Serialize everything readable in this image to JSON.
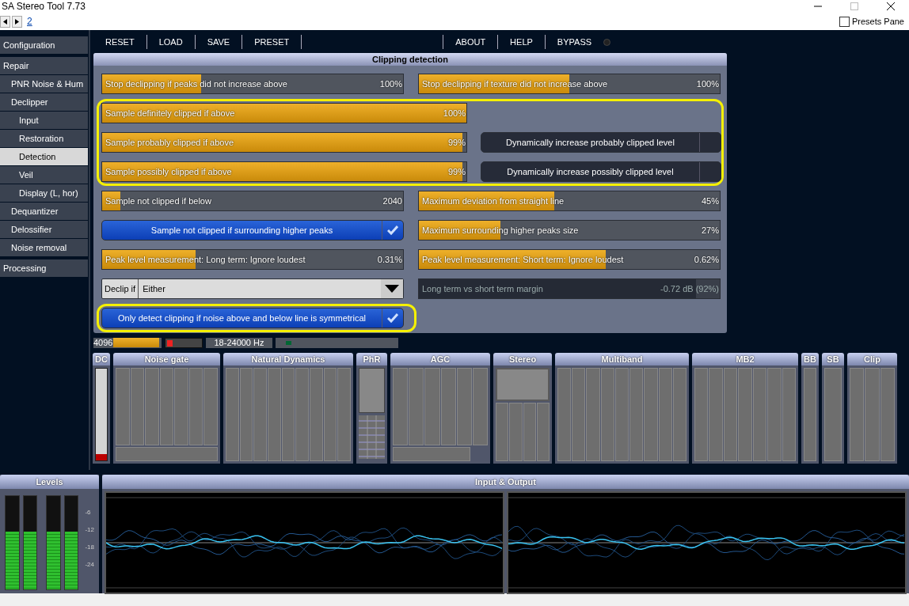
{
  "window": {
    "title": "SA Stereo Tool 7.73"
  },
  "nav": {
    "page": "2"
  },
  "presets_pane": {
    "label": "Presets Pane",
    "checked": false
  },
  "sidebar": {
    "items": [
      {
        "label": "Configuration",
        "selected": false
      },
      {
        "label": "Repair",
        "selected": false,
        "children": [
          {
            "label": "PNR Noise & Hum",
            "selected": false
          },
          {
            "label": "Declipper",
            "selected": false,
            "children": [
              {
                "label": "Input",
                "selected": false
              },
              {
                "label": "Restoration",
                "selected": false
              },
              {
                "label": "Detection",
                "selected": true
              },
              {
                "label": "Veil",
                "selected": false
              },
              {
                "label": "Display (L, hor)",
                "selected": false
              }
            ]
          },
          {
            "label": "Dequantizer",
            "selected": false
          },
          {
            "label": "Delossifier",
            "selected": false
          },
          {
            "label": "Noise removal",
            "selected": false
          }
        ]
      },
      {
        "label": "Processing",
        "selected": false
      }
    ]
  },
  "toolbar": {
    "left": [
      "RESET",
      "LOAD",
      "SAVE",
      "PRESET"
    ],
    "right": [
      "ABOUT",
      "HELP",
      "BYPASS"
    ]
  },
  "panel": {
    "title": "Clipping detection",
    "groups": [
      {
        "highlighted": false,
        "rows": [
          [
            {
              "kind": "slider",
              "label": "Stop declipping if peaks did not increase above",
              "value": "100%",
              "level": 0.33
            },
            {
              "kind": "slider",
              "label": "Stop declipping if texture did not increase above",
              "value": "100%",
              "level": 0.5
            }
          ]
        ]
      },
      {
        "highlighted": true,
        "rows": [
          [
            {
              "kind": "slider",
              "label": "Sample definitely clipped if above",
              "value": "100%",
              "level": 1
            }
          ],
          [
            {
              "kind": "slider",
              "label": "Sample probably clipped if above",
              "value": "99%",
              "level": 0.99
            },
            {
              "kind": "toggle",
              "label": "Dynamically increase probably clipped level",
              "on": false
            }
          ],
          [
            {
              "kind": "slider",
              "label": "Sample possibly clipped if above",
              "value": "99%",
              "level": 0.99
            },
            {
              "kind": "toggle",
              "label": "Dynamically increase possibly clipped level",
              "on": false
            }
          ]
        ]
      },
      {
        "highlighted": false,
        "rows": [
          [
            {
              "kind": "slider",
              "label": "Sample not clipped if below",
              "value": "2040",
              "level": 0.06
            },
            {
              "kind": "slider",
              "label": "Maximum deviation from straight line",
              "value": "45%",
              "level": 0.45
            }
          ],
          [
            {
              "kind": "toggle",
              "label": "Sample not clipped if surrounding higher peaks",
              "on": true
            },
            {
              "kind": "slider",
              "label": "Maximum surrounding higher peaks size",
              "value": "27%",
              "level": 0.27
            }
          ],
          [
            {
              "kind": "slider",
              "label": "Peak level measurement: Long term: Ignore loudest",
              "value": "0.31%",
              "level": 0.31
            },
            {
              "kind": "slider",
              "label": "Peak level measurement: Short term: Ignore loudest",
              "value": "0.62%",
              "level": 0.62
            }
          ],
          [
            {
              "kind": "dropdown",
              "label": "Declip if",
              "value": "Either"
            },
            {
              "kind": "slider",
              "label": "Long term vs short term margin",
              "value": "-0.72 dB (92%)",
              "level": 0.92,
              "disabled": true
            }
          ]
        ]
      },
      {
        "highlighted": true,
        "rows": [
          [
            {
              "kind": "toggle",
              "label": "Only detect clipping if noise above and below line is symmetrical",
              "on": true
            }
          ]
        ]
      }
    ]
  },
  "status": {
    "block_size": "4096",
    "frequency": "18-24000 Hz"
  },
  "modules": [
    {
      "title": "DC",
      "kind": "meter"
    },
    {
      "title": "Noise gate",
      "kind": "faders"
    },
    {
      "title": "Natural Dynamics",
      "kind": "faders"
    },
    {
      "title": "PhR",
      "kind": "phase"
    },
    {
      "title": "AGC",
      "kind": "faders"
    },
    {
      "title": "Stereo",
      "kind": "stereo"
    },
    {
      "title": "Multiband",
      "kind": "faders"
    },
    {
      "title": "MB2",
      "kind": "faders"
    },
    {
      "title": "BB",
      "kind": "faders"
    },
    {
      "title": "SB",
      "kind": "faders"
    },
    {
      "title": "Clip",
      "kind": "faders"
    }
  ],
  "levels": {
    "title": "Levels",
    "scale": [
      "-6",
      "-12",
      "-18",
      "-24"
    ],
    "meters": [
      {
        "level": 0.62
      },
      {
        "level": 0.62
      },
      {
        "level": 0.62
      },
      {
        "level": 0.62
      }
    ]
  },
  "scope": {
    "title": "Input & Output"
  }
}
